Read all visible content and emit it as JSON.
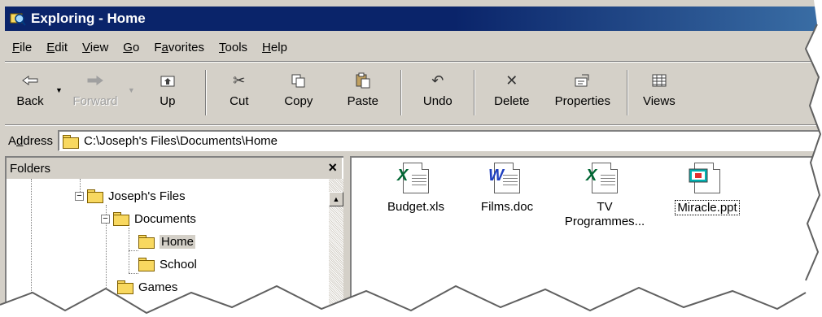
{
  "window": {
    "title": "Exploring - Home",
    "title_bar_color": "#0a246a"
  },
  "menu": [
    {
      "label": "File"
    },
    {
      "label": "Edit"
    },
    {
      "label": "View"
    },
    {
      "label": "Go"
    },
    {
      "label": "Favorites"
    },
    {
      "label": "Tools"
    },
    {
      "label": "Help"
    }
  ],
  "toolbar": {
    "back": {
      "label": "Back",
      "icon": "back-arrow-icon"
    },
    "forward": {
      "label": "Forward",
      "icon": "forward-arrow-icon",
      "disabled": true
    },
    "up": {
      "label": "Up",
      "icon": "up-folder-icon"
    },
    "cut": {
      "label": "Cut",
      "icon": "scissors-icon"
    },
    "copy": {
      "label": "Copy",
      "icon": "copy-icon"
    },
    "paste": {
      "label": "Paste",
      "icon": "paste-icon"
    },
    "undo": {
      "label": "Undo",
      "icon": "undo-icon"
    },
    "delete": {
      "label": "Delete",
      "icon": "delete-x-icon"
    },
    "properties": {
      "label": "Properties",
      "icon": "properties-icon"
    },
    "views": {
      "label": "Views",
      "icon": "views-grid-icon"
    }
  },
  "address": {
    "label": "Address",
    "value": "C:\\Joseph's Files\\Documents\\Home"
  },
  "folders_pane": {
    "title": "Folders",
    "close_glyph": "×",
    "tree": [
      {
        "label": "Joseph's Files",
        "expanded": true
      },
      {
        "label": "Documents",
        "expanded": true
      },
      {
        "label": "Home",
        "selected": true,
        "open": true
      },
      {
        "label": "School"
      },
      {
        "label": "Games"
      }
    ]
  },
  "files": [
    {
      "name": "Budget.xls",
      "icon": "excel-file-icon",
      "glyph": "X",
      "color": "#006633"
    },
    {
      "name": "Films.doc",
      "icon": "word-file-icon",
      "glyph": "W",
      "color": "#1f3fbf"
    },
    {
      "name": "TV\nProgrammes...",
      "icon": "excel-file-icon",
      "glyph": "X",
      "color": "#006633"
    },
    {
      "name": "Miracle.ppt",
      "icon": "powerpoint-file-icon",
      "selected": true
    }
  ]
}
